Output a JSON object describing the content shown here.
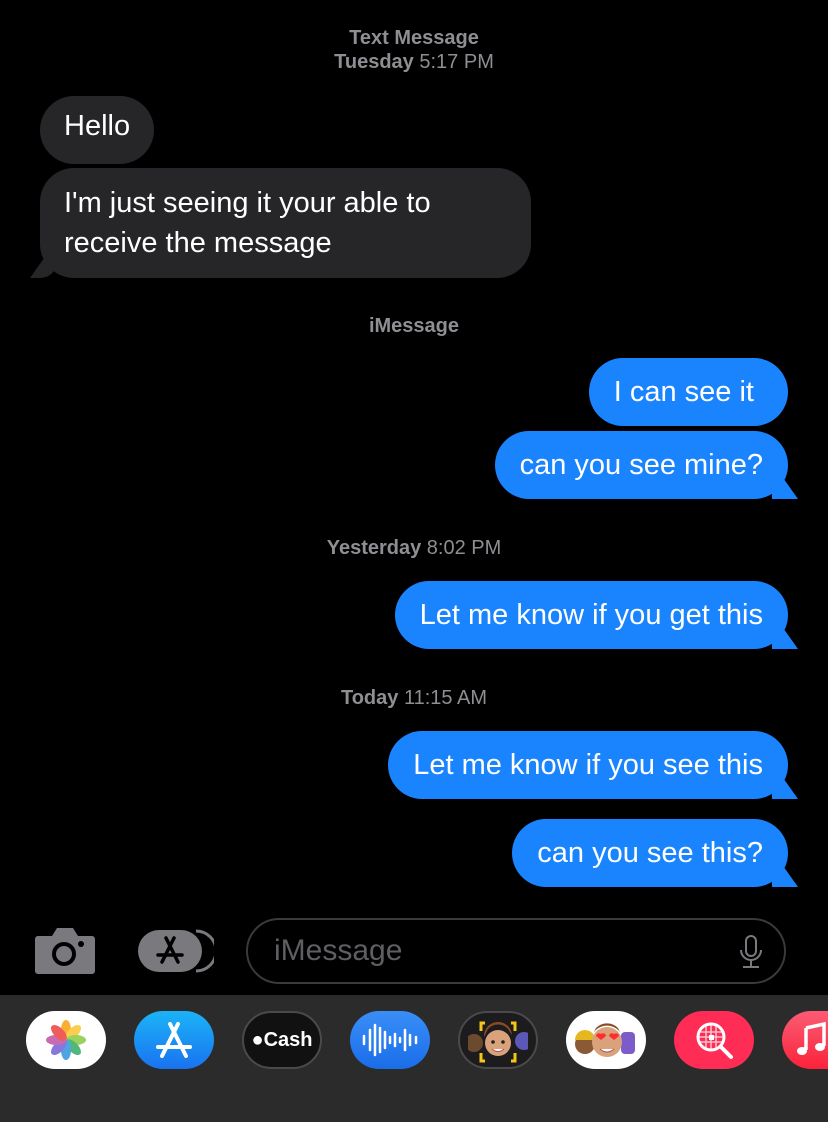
{
  "header": {
    "service": "Text Message",
    "day": "Tuesday",
    "time": "5:17 PM"
  },
  "thread": {
    "received": [
      {
        "text": "Hello"
      },
      {
        "text_line1": "I'm just seeing it your able to",
        "text_line2": "receive the message"
      }
    ],
    "service_label": "iMessage",
    "sent_group1": [
      {
        "text": "I can see it"
      },
      {
        "text": "can you see mine?"
      }
    ],
    "ts2": {
      "day": "Yesterday",
      "time": "8:02 PM"
    },
    "sent_group2": [
      {
        "text": "Let me know if you get this"
      }
    ],
    "ts3": {
      "day": "Today",
      "time": "11:15 AM"
    },
    "sent_group3": [
      {
        "text": "Let me know if you see this"
      },
      {
        "text": "can you see this?"
      }
    ]
  },
  "composer": {
    "placeholder": "iMessage",
    "camera_icon": "camera-icon",
    "apps_icon": "app-store-icon",
    "mic_icon": "microphone-icon"
  },
  "app_drawer": {
    "apps": [
      {
        "name": "Photos",
        "icon": "photos-icon"
      },
      {
        "name": "App Store",
        "icon": "app-store-icon"
      },
      {
        "name": "Apple Cash",
        "label": "Cash",
        "icon": "apple-cash-icon"
      },
      {
        "name": "Audio Message",
        "icon": "audio-waveform-icon"
      },
      {
        "name": "Memoji",
        "icon": "memoji-icon"
      },
      {
        "name": "Memoji Stickers",
        "icon": "memoji-stickers-icon"
      },
      {
        "name": "Images Search",
        "icon": "globe-search-icon"
      },
      {
        "name": "Music",
        "icon": "music-icon"
      }
    ]
  },
  "colors": {
    "sent_bubble": "#1a84ff",
    "received_bubble": "#262629",
    "timestamp": "#8e8e93",
    "background": "#000000"
  }
}
